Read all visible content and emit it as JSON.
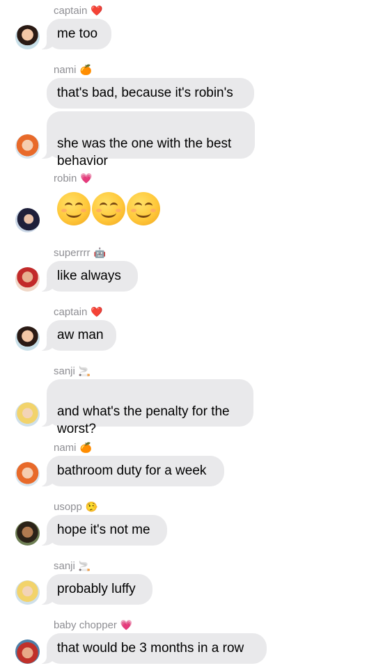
{
  "messages": [
    {
      "sender": "captain",
      "sender_emoji": "❤️",
      "text": "me too",
      "avatar": "luffy-avatar"
    },
    {
      "sender": "nami",
      "sender_emoji": "🍊",
      "texts": [
        "that's bad, because it's robin's",
        "she was the one with the best\nbehavior"
      ],
      "avatar": "nami-avatar"
    },
    {
      "sender": "robin",
      "sender_emoji": "💗",
      "emoji_message": "😊😊😊",
      "avatar": "robin-avatar"
    },
    {
      "sender": "superrrr",
      "sender_emoji": "🤖",
      "text": "like always",
      "avatar": "franky-avatar"
    },
    {
      "sender": "captain",
      "sender_emoji": "❤️",
      "text": "aw man",
      "avatar": "luffy-avatar"
    },
    {
      "sender": "sanji",
      "sender_emoji": "🚬",
      "text": "and what's the penalty for the\nworst?",
      "avatar": "sanji-avatar"
    },
    {
      "sender": "nami",
      "sender_emoji": "🍊",
      "text": "bathroom duty for a week",
      "avatar": "nami-avatar"
    },
    {
      "sender": "usopp",
      "sender_emoji": "🤥",
      "text": "hope it's not me",
      "avatar": "usopp-avatar"
    },
    {
      "sender": "sanji",
      "sender_emoji": "🚬",
      "text": "probably luffy",
      "avatar": "sanji-avatar"
    },
    {
      "sender": "baby chopper",
      "sender_emoji": "💗",
      "text": "that would be 3 months in a row",
      "avatar": "chopper-avatar"
    }
  ],
  "colors": {
    "bubble": "#e9e9eb",
    "sender_text": "#8e8e93",
    "background": "#ffffff"
  }
}
